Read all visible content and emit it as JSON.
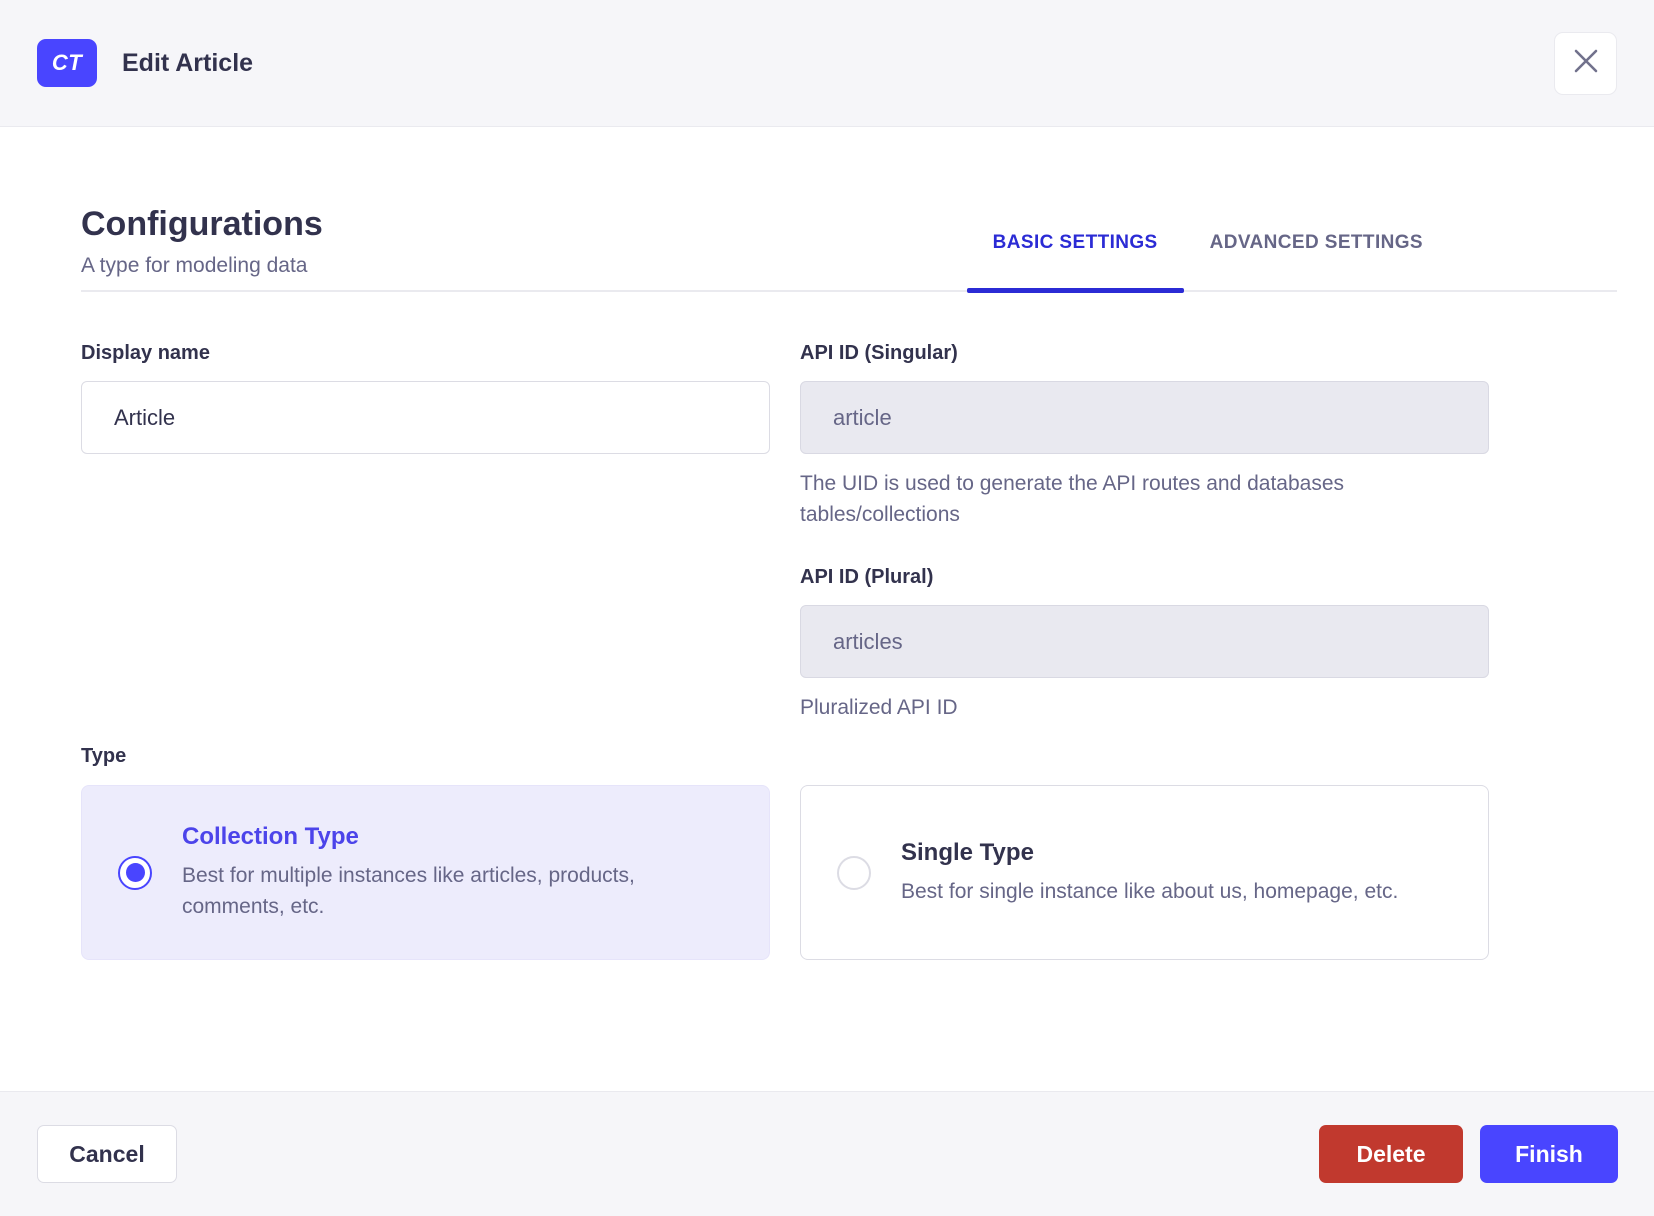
{
  "header": {
    "badge_label": "CT",
    "title": "Edit Article"
  },
  "configurations": {
    "title": "Configurations",
    "subtitle": "A type for modeling data",
    "tabs": [
      {
        "label": "BASIC SETTINGS",
        "active": true
      },
      {
        "label": "ADVANCED SETTINGS",
        "active": false
      }
    ]
  },
  "form": {
    "display_name": {
      "label": "Display name",
      "value": "Article"
    },
    "api_id_singular": {
      "label": "API ID (Singular)",
      "value": "article",
      "hint": "The UID is used to generate the API routes and databases tables/collections"
    },
    "api_id_plural": {
      "label": "API ID (Plural)",
      "value": "articles",
      "hint": "Pluralized API ID"
    },
    "type": {
      "label": "Type",
      "options": [
        {
          "title": "Collection Type",
          "description": "Best for multiple instances like articles, products, comments, etc.",
          "selected": true
        },
        {
          "title": "Single Type",
          "description": "Best for single instance like about us, homepage, etc.",
          "selected": false
        }
      ]
    }
  },
  "footer": {
    "cancel_label": "Cancel",
    "delete_label": "Delete",
    "finish_label": "Finish"
  },
  "colors": {
    "primary": "#4945ff",
    "tab_active": "#2b2bd5",
    "danger": "#c1392e",
    "text_dark": "#32324d",
    "text_muted": "#666687",
    "selected_card_bg": "#edecfc",
    "header_bg": "#f6f6f9"
  }
}
